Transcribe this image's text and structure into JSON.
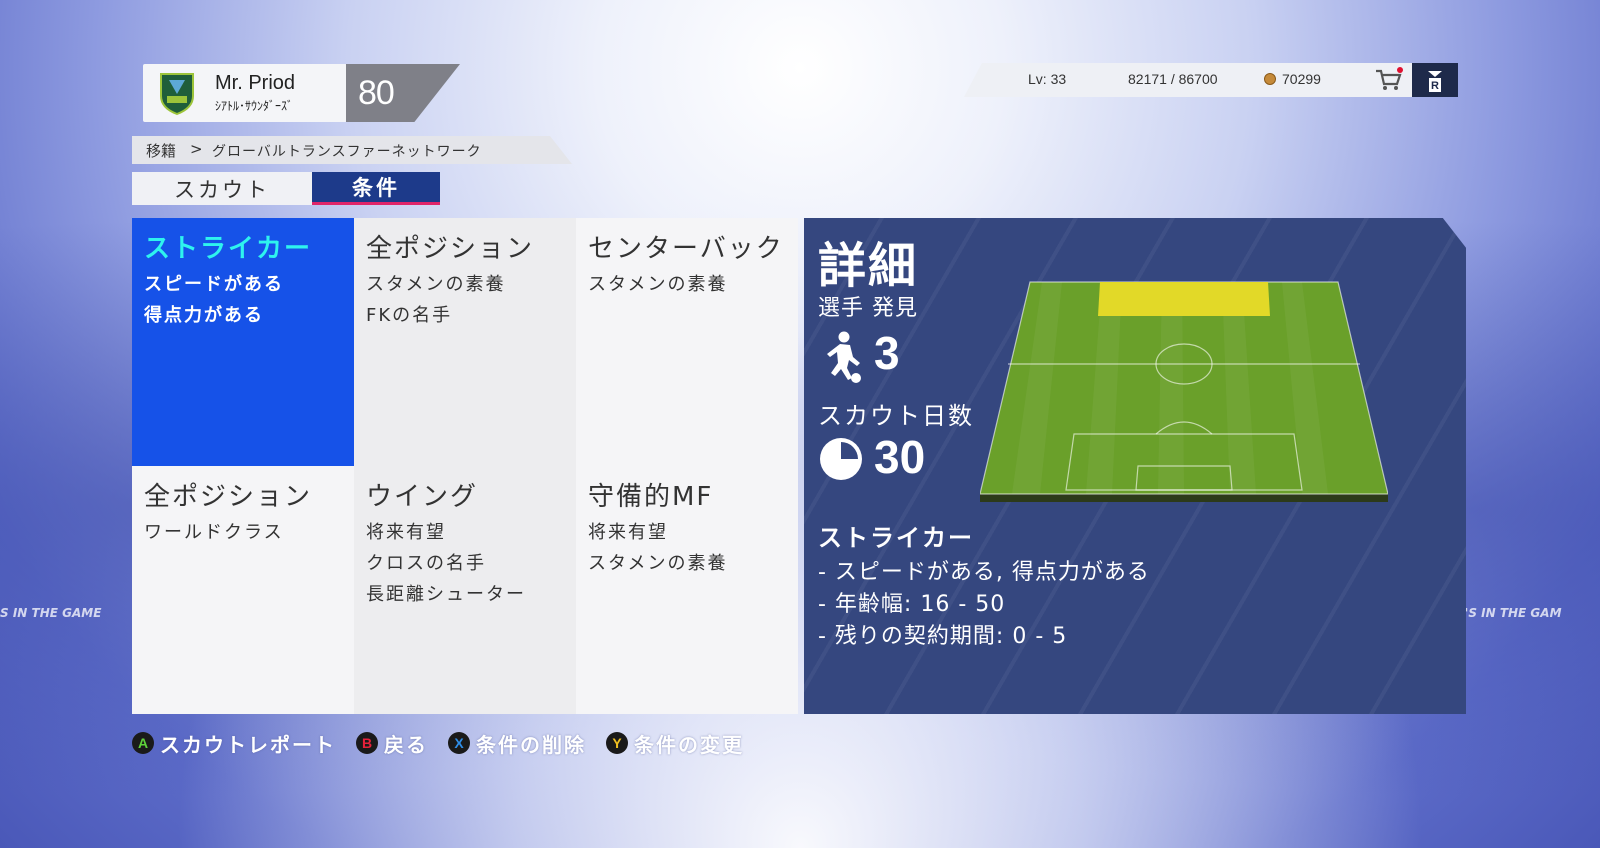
{
  "background": {
    "stand_text_left": "S IN THE GAME",
    "stand_text_right": "IT'S IN THE GAM"
  },
  "header": {
    "manager_name": "Mr. Priod",
    "club_name": "ｼｱﾄﾙ･ｻｳﾝﾀﾞｰｽﾞ",
    "rating": "80",
    "crest_icon": "sounders-crest-icon"
  },
  "stats": {
    "level": "Lv: 33",
    "xp": "82171 / 86700",
    "coins": "70299",
    "cart_icon": "cart-icon",
    "colors": {
      "notify": "#e01030",
      "coin": "#c58a3a"
    }
  },
  "breadcrumb": {
    "root": "移籍",
    "separator": ">",
    "current": "グローバルトランスファーネットワーク"
  },
  "tabs": [
    {
      "label": "スカウト",
      "active": false
    },
    {
      "label": "条件",
      "active": true
    }
  ],
  "conditions": [
    {
      "title": "ストライカー",
      "lines": [
        "スピードがある",
        "得点力がある"
      ],
      "selected": true
    },
    {
      "title": "全ポジション",
      "lines": [
        "スタメンの素養",
        "FKの名手"
      ],
      "selected": false
    },
    {
      "title": "センターバック",
      "lines": [
        "スタメンの素養"
      ],
      "selected": false
    },
    {
      "title": "全ポジション",
      "lines": [
        "ワールドクラス"
      ],
      "selected": false
    },
    {
      "title": "ウイング",
      "lines": [
        "将来有望",
        "クロスの名手",
        "長距離シューター"
      ],
      "selected": false
    },
    {
      "title": "守備的MF",
      "lines": [
        "将来有望",
        "スタメンの素養"
      ],
      "selected": false
    }
  ],
  "detail": {
    "title": "詳細",
    "players_found_label": "選手 発見",
    "players_found": "3",
    "scout_days_label": "スカウト日数",
    "scout_days": "30",
    "position": "ストライカー",
    "lines": [
      "- スピードがある, 得点力がある",
      "- 年齢幅: 16 - 50",
      "- 残りの契約期間: 0 - 5"
    ],
    "colors": {
      "panel": "#35477f",
      "pitch": "#6aa02a",
      "zone": "#e2d928"
    }
  },
  "hints": [
    {
      "button": "A",
      "label": "スカウトレポート",
      "color": "#5fd13a"
    },
    {
      "button": "B",
      "label": "戻る",
      "color": "#e8213a"
    },
    {
      "button": "X",
      "label": "条件の削除",
      "color": "#2f8ee8"
    },
    {
      "button": "Y",
      "label": "条件の変更",
      "color": "#f0c020"
    }
  ]
}
